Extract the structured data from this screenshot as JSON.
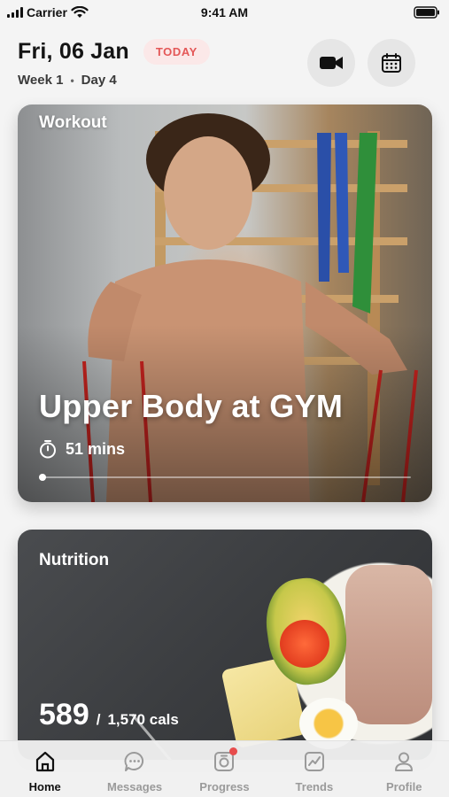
{
  "status_bar": {
    "carrier": "Carrier",
    "time": "9:41 AM"
  },
  "header": {
    "date": "Fri, 06 Jan",
    "today_badge": "TODAY",
    "week": "Week 1",
    "day": "Day 4",
    "video_button_icon": "video-camera-icon",
    "calendar_button_icon": "calendar-icon"
  },
  "workout": {
    "section_label": "Workout",
    "title": "Upper Body at GYM",
    "duration": "51 mins",
    "progress": 0.0
  },
  "nutrition": {
    "section_label": "Nutrition",
    "calories_eaten": "589",
    "separator": "/",
    "calories_goal": "1,570 cals"
  },
  "tab_bar": {
    "items": [
      {
        "label": "Home",
        "icon": "home-icon",
        "active": true
      },
      {
        "label": "Messages",
        "icon": "chat-icon",
        "active": false
      },
      {
        "label": "Progress",
        "icon": "camera-icon",
        "active": false,
        "notification": true
      },
      {
        "label": "Trends",
        "icon": "trend-chart-icon",
        "active": false
      },
      {
        "label": "Profile",
        "icon": "user-icon",
        "active": false
      }
    ]
  },
  "colors": {
    "accent_red": "#e45757",
    "today_bg": "#fbe8e8"
  }
}
